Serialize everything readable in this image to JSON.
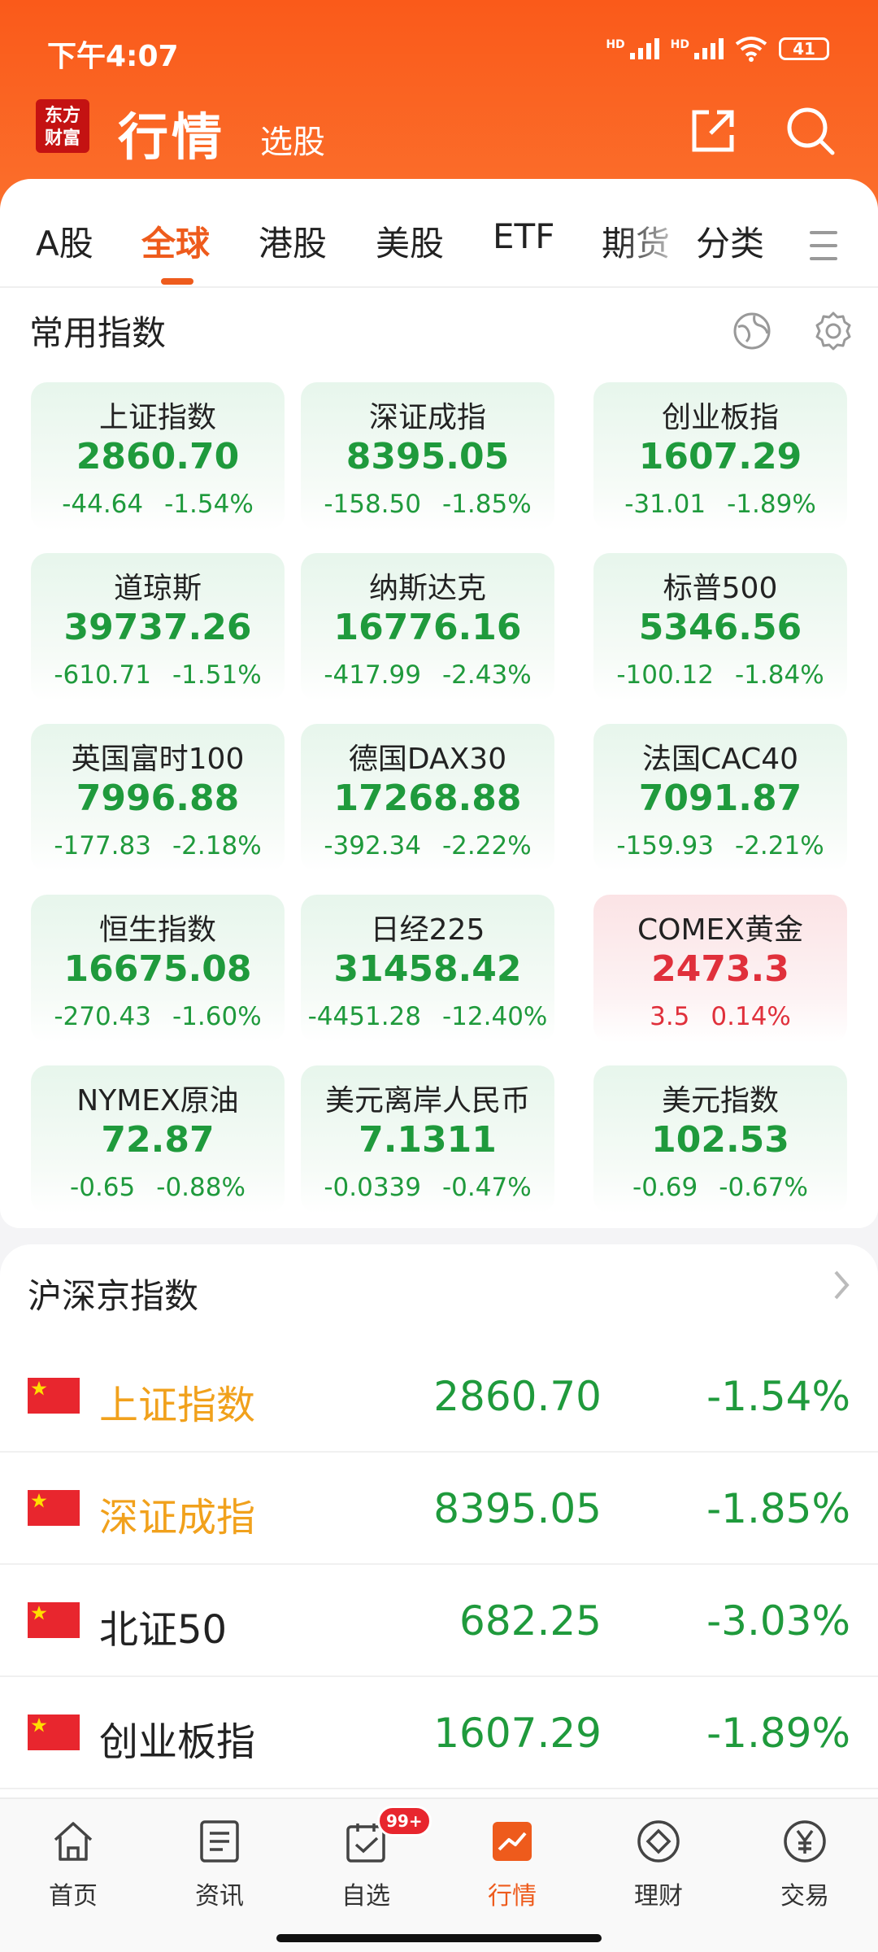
{
  "status_bar": {
    "time": "下午4:07",
    "hd1": "HD",
    "hd2": "HD",
    "battery": "41"
  },
  "app_bar": {
    "logo_line1": "东方",
    "logo_line2": "财富",
    "title": "行情",
    "subtitle": "选股"
  },
  "tabs": [
    "A股",
    "全球",
    "港股",
    "美股",
    "ETF",
    "期货",
    "分类"
  ],
  "active_tab": "全球",
  "common_indices": {
    "title": "常用指数",
    "items": [
      {
        "name": "上证指数",
        "value": "2860.70",
        "change": "-44.64",
        "pct": "-1.54%",
        "trend": "down"
      },
      {
        "name": "深证成指",
        "value": "8395.05",
        "change": "-158.50",
        "pct": "-1.85%",
        "trend": "down"
      },
      {
        "name": "创业板指",
        "value": "1607.29",
        "change": "-31.01",
        "pct": "-1.89%",
        "trend": "down"
      },
      {
        "name": "道琼斯",
        "value": "39737.26",
        "change": "-610.71",
        "pct": "-1.51%",
        "trend": "down"
      },
      {
        "name": "纳斯达克",
        "value": "16776.16",
        "change": "-417.99",
        "pct": "-2.43%",
        "trend": "down"
      },
      {
        "name": "标普500",
        "value": "5346.56",
        "change": "-100.12",
        "pct": "-1.84%",
        "trend": "down"
      },
      {
        "name": "英国富时100",
        "value": "7996.88",
        "change": "-177.83",
        "pct": "-2.18%",
        "trend": "down"
      },
      {
        "name": "德国DAX30",
        "value": "17268.88",
        "change": "-392.34",
        "pct": "-2.22%",
        "trend": "down"
      },
      {
        "name": "法国CAC40",
        "value": "7091.87",
        "change": "-159.93",
        "pct": "-2.21%",
        "trend": "down"
      },
      {
        "name": "恒生指数",
        "value": "16675.08",
        "change": "-270.43",
        "pct": "-1.60%",
        "trend": "down"
      },
      {
        "name": "日经225",
        "value": "31458.42",
        "change": "-4451.28",
        "pct": "-12.40%",
        "trend": "down"
      },
      {
        "name": "COMEX黄金",
        "value": "2473.3",
        "change": "3.5",
        "pct": "0.14%",
        "trend": "up"
      },
      {
        "name": "NYMEX原油",
        "value": "72.87",
        "change": "-0.65",
        "pct": "-0.88%",
        "trend": "down"
      },
      {
        "name": "美元离岸人民币",
        "value": "7.1311",
        "change": "-0.0339",
        "pct": "-0.47%",
        "trend": "down"
      },
      {
        "name": "美元指数",
        "value": "102.53",
        "change": "-0.69",
        "pct": "-0.67%",
        "trend": "down"
      }
    ]
  },
  "hsj_indices": {
    "title": "沪深京指数",
    "rows": [
      {
        "name": "上证指数",
        "value": "2860.70",
        "pct": "-1.54%",
        "highlight": true
      },
      {
        "name": "深证成指",
        "value": "8395.05",
        "pct": "-1.85%",
        "highlight": true
      },
      {
        "name": "北证50",
        "value": "682.25",
        "pct": "-3.03%",
        "highlight": false
      },
      {
        "name": "创业板指",
        "value": "1607.29",
        "pct": "-1.89%",
        "highlight": false
      }
    ]
  },
  "bottom_nav": {
    "items": [
      {
        "label": "首页",
        "icon": "home-icon"
      },
      {
        "label": "资讯",
        "icon": "news-icon"
      },
      {
        "label": "自选",
        "icon": "watchlist-icon",
        "badge": "99+"
      },
      {
        "label": "行情",
        "icon": "market-icon"
      },
      {
        "label": "理财",
        "icon": "wealth-icon"
      },
      {
        "label": "交易",
        "icon": "trade-icon"
      }
    ],
    "active": "行情"
  },
  "colors": {
    "brand": "#fa5a1a",
    "down": "#1f9a3c",
    "up": "#e0303b",
    "highlight": "#f1a11c"
  }
}
